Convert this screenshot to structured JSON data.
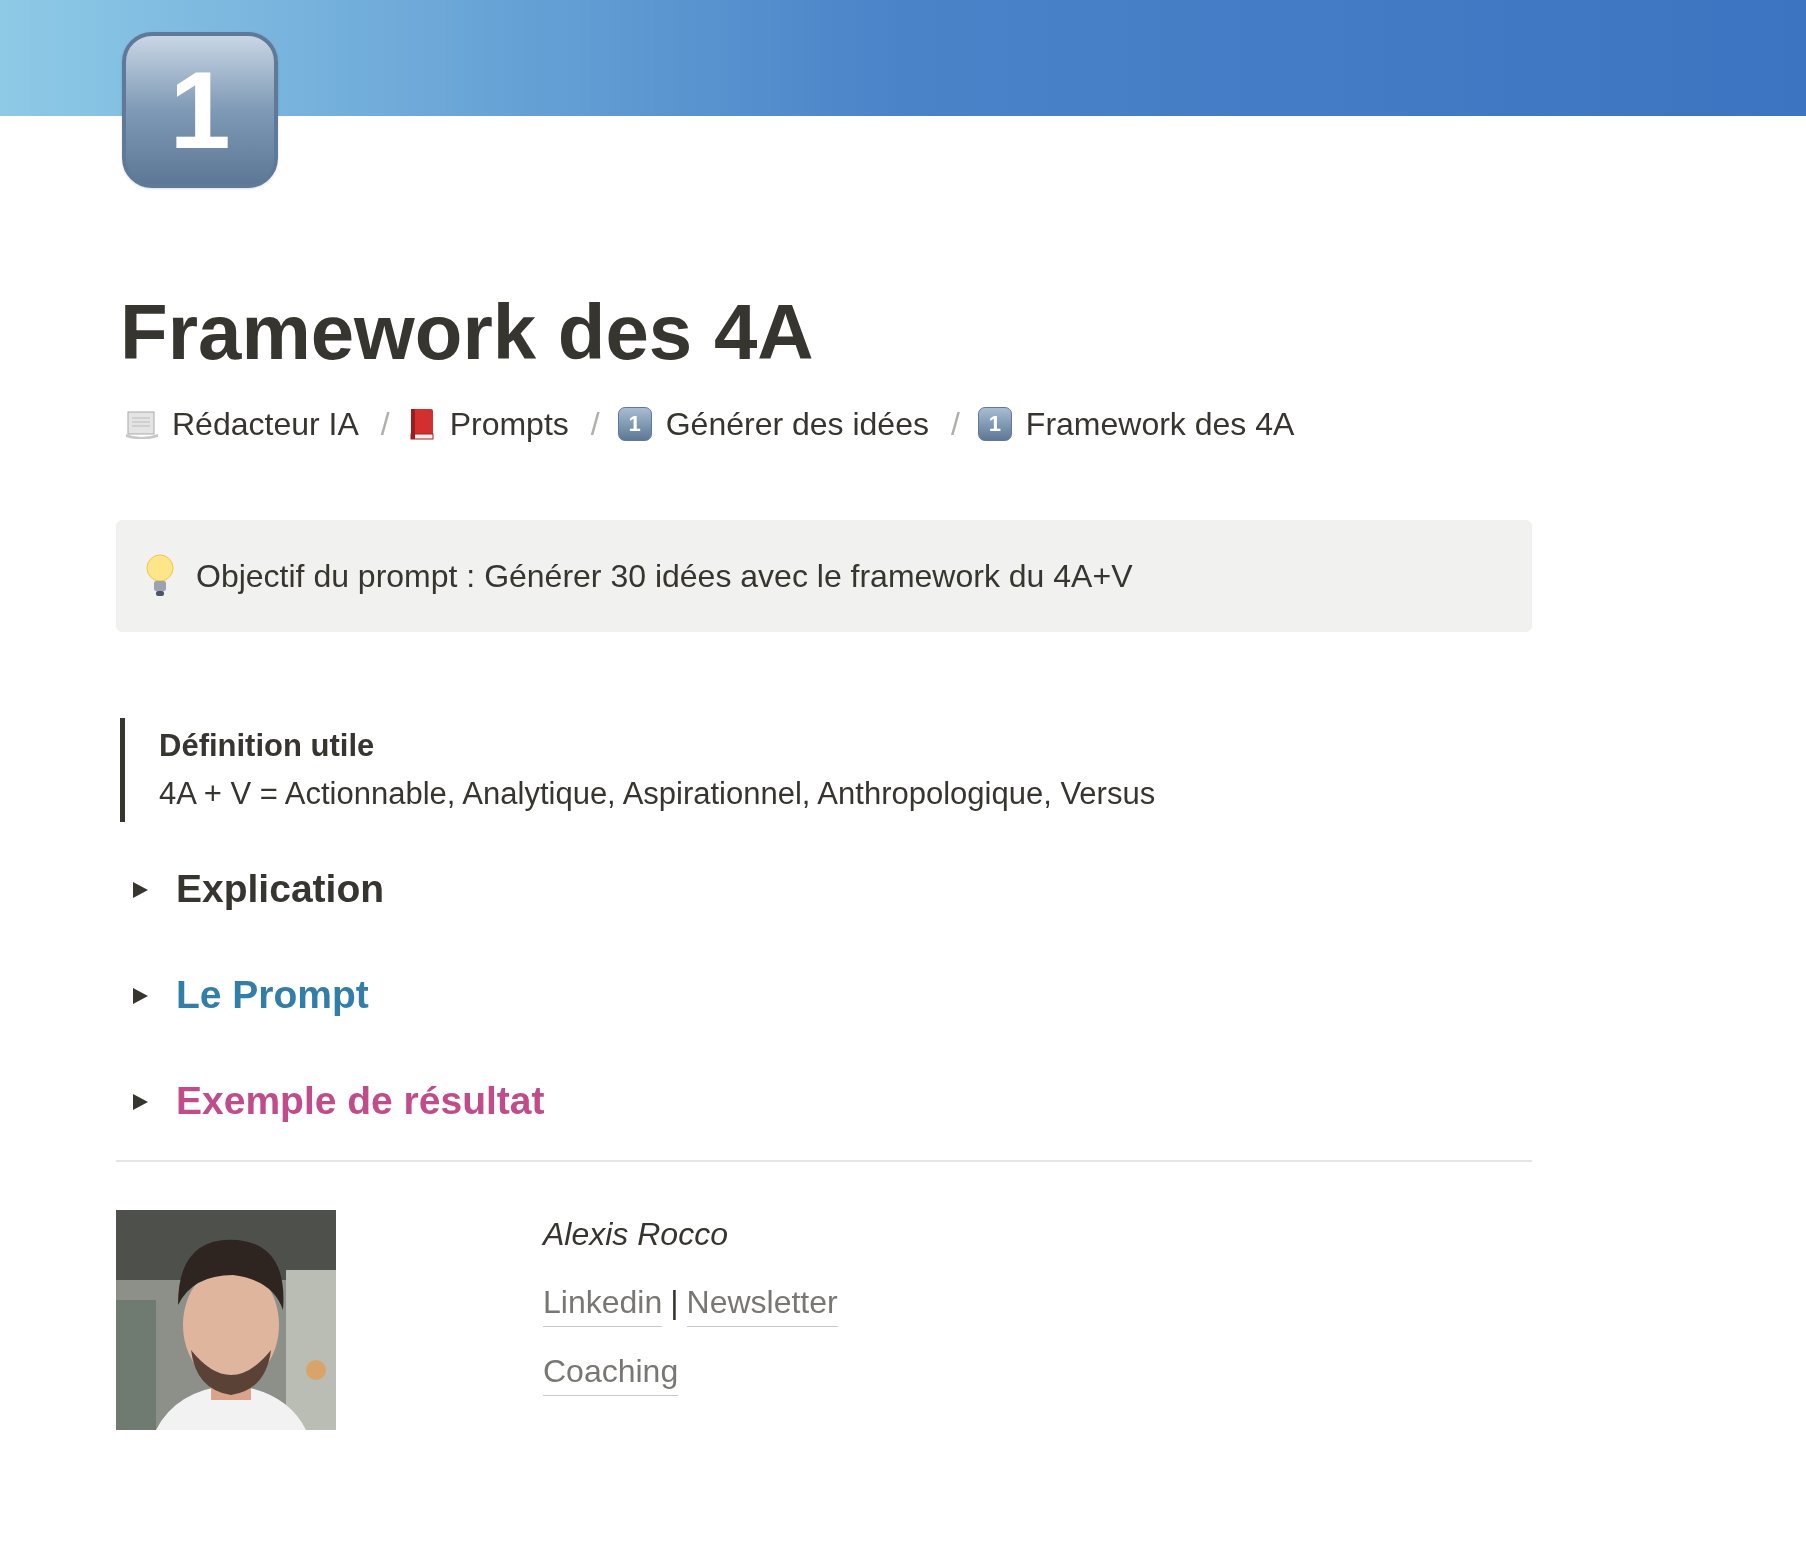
{
  "page_icon": {
    "text": "1"
  },
  "title": "Framework des 4A",
  "breadcrumb": [
    {
      "kind": "scroll",
      "label": "Rédacteur IA"
    },
    {
      "separator": "/",
      "kind": "book",
      "label": "Prompts"
    },
    {
      "separator": "/",
      "kind": "keycap",
      "icon_text": "1",
      "label": "Générer des idées"
    },
    {
      "separator": "/",
      "kind": "keycap",
      "icon_text": "1",
      "label": "Framework des 4A"
    }
  ],
  "callout": {
    "text": "Objectif du prompt : Générer 30 idées avec le framework du 4A+V"
  },
  "quote": {
    "heading": "Définition utile",
    "text": "4A + V = Actionnable, Analytique, Aspirationnel, Anthropologique, Versus"
  },
  "toggles": [
    {
      "label": "Explication",
      "expanded": false,
      "color": "#37352f"
    },
    {
      "label": "Le Prompt",
      "expanded": false,
      "color": "#337ea9"
    },
    {
      "label": "Exemple de résultat",
      "expanded": false,
      "color": "#c14c8a"
    }
  ],
  "author": {
    "photo": {
      "kind": "picture"
    },
    "name": "Alexis Rocco",
    "links": [
      "Linkedin",
      "Newsletter"
    ],
    "separator": "|",
    "coaching": "Coaching"
  }
}
